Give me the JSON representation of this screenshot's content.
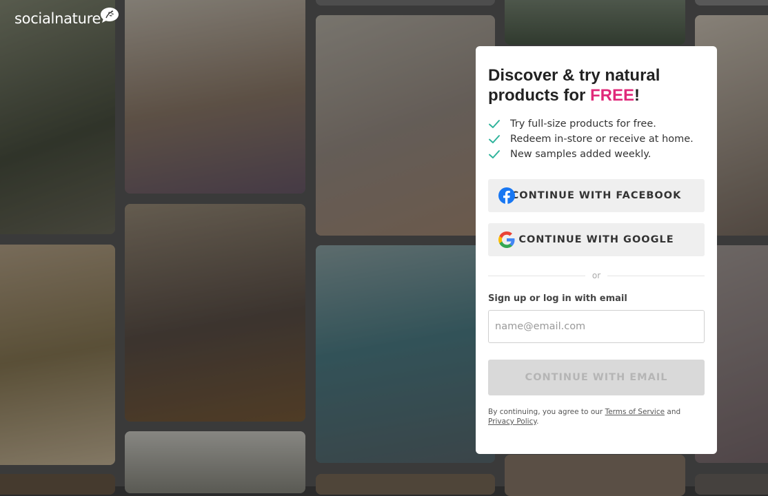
{
  "brand": {
    "name": "socialnature",
    "logo_icon": "leaf-bubble-icon"
  },
  "colors": {
    "accent": "#e0297a",
    "check": "#2fb39b",
    "facebook": "#1877f2"
  },
  "card": {
    "headline_part1": "Discover & try natural products for ",
    "headline_highlight": "FREE",
    "headline_end": "!",
    "benefits": [
      "Try full-size products for free.",
      "Redeem in-store or receive at home.",
      "New samples added weekly."
    ],
    "facebook_button": "CONTINUE WITH FACEBOOK",
    "google_button": "CONTINUE WITH GOOGLE",
    "divider": "or",
    "email_label": "Sign up or log in with email",
    "email_placeholder": "name@email.com",
    "email_button": "CONTINUE WITH EMAIL",
    "legal_prefix": "By continuing, you agree to our ",
    "terms_link": "Terms of Service",
    "legal_and": " and",
    "privacy_link": "Privacy Policy",
    "legal_suffix": "."
  }
}
